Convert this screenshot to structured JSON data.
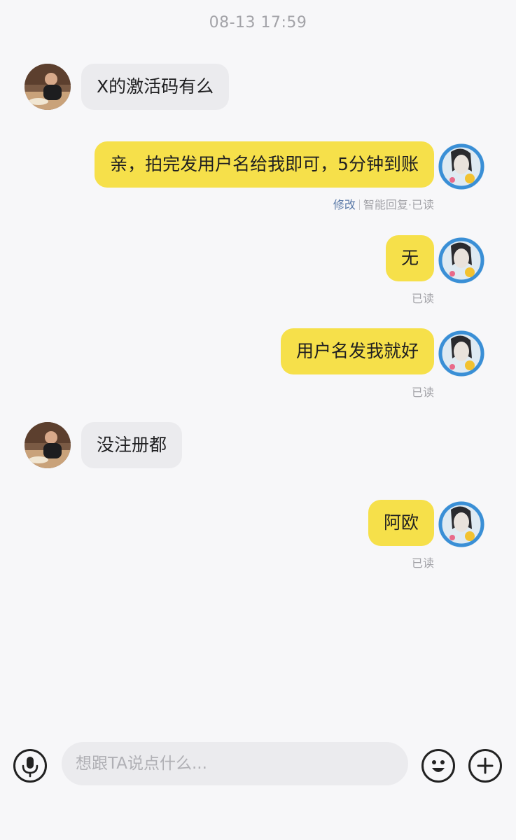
{
  "header": {
    "timestamp": "08-13 17:59"
  },
  "messages": [
    {
      "text": "X的激活码有么"
    },
    {
      "text": "亲，拍完发用户名给我即可，5分钟到账",
      "edit_label": "修改",
      "status": "智能回复·已读"
    },
    {
      "text": "无",
      "status": "已读"
    },
    {
      "text": "用户名发我就好",
      "status": "已读"
    },
    {
      "text": "没注册都"
    },
    {
      "text": "阿欧",
      "status": "已读"
    }
  ],
  "input": {
    "placeholder": "想跟TA说点什么..."
  },
  "icons": {
    "voice": "microphone-icon",
    "emoji": "smiley-icon",
    "more": "plus-icon"
  },
  "colors": {
    "outgoing_bubble": "#f6e04a",
    "incoming_bubble": "#ebebee",
    "edit_link": "#5a79a8"
  }
}
